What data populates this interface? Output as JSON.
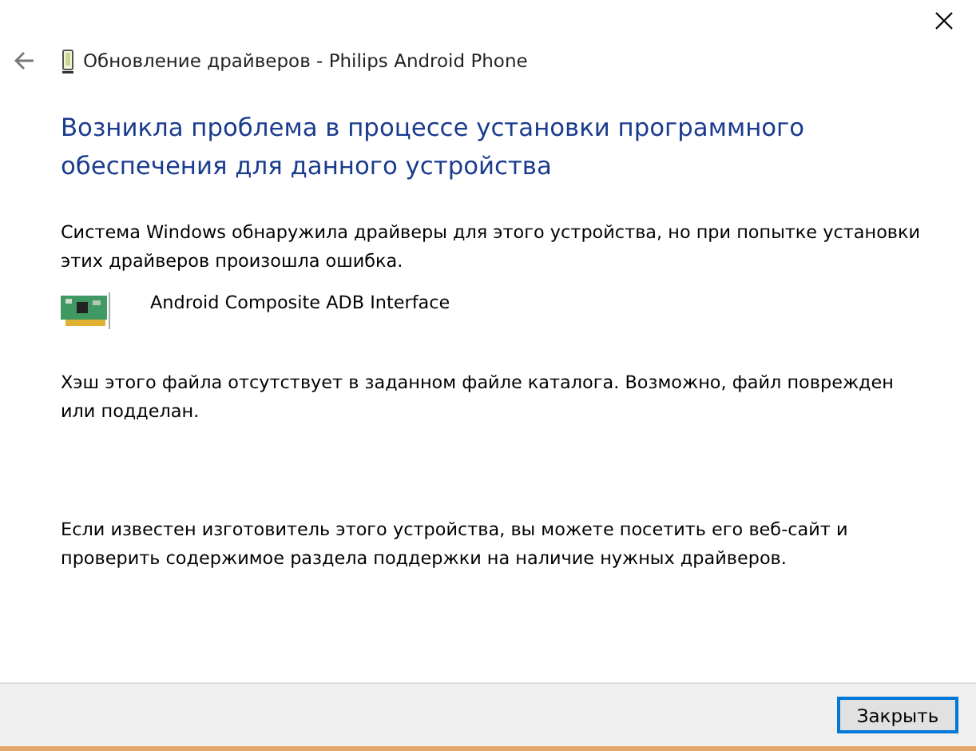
{
  "window": {
    "title": "Обновление драйверов - Philips Android Phone"
  },
  "heading": "Возникла проблема в процессе установки программного обеспечения для данного устройства",
  "message": "Система Windows обнаружила драйверы для этого устройства, но при попытке установки этих драйверов произошла ошибка.",
  "device": {
    "name": "Android Composite ADB Interface"
  },
  "error": "Хэш этого файла отсутствует в заданном файле каталога. Возможно, файл поврежден или подделан.",
  "advice": "Если известен изготовитель этого устройства, вы можете посетить его веб-сайт и проверить содержимое раздела поддержки на наличие нужных драйверов.",
  "buttons": [
    {
      "label": "Закрыть",
      "selected": true
    }
  ]
}
